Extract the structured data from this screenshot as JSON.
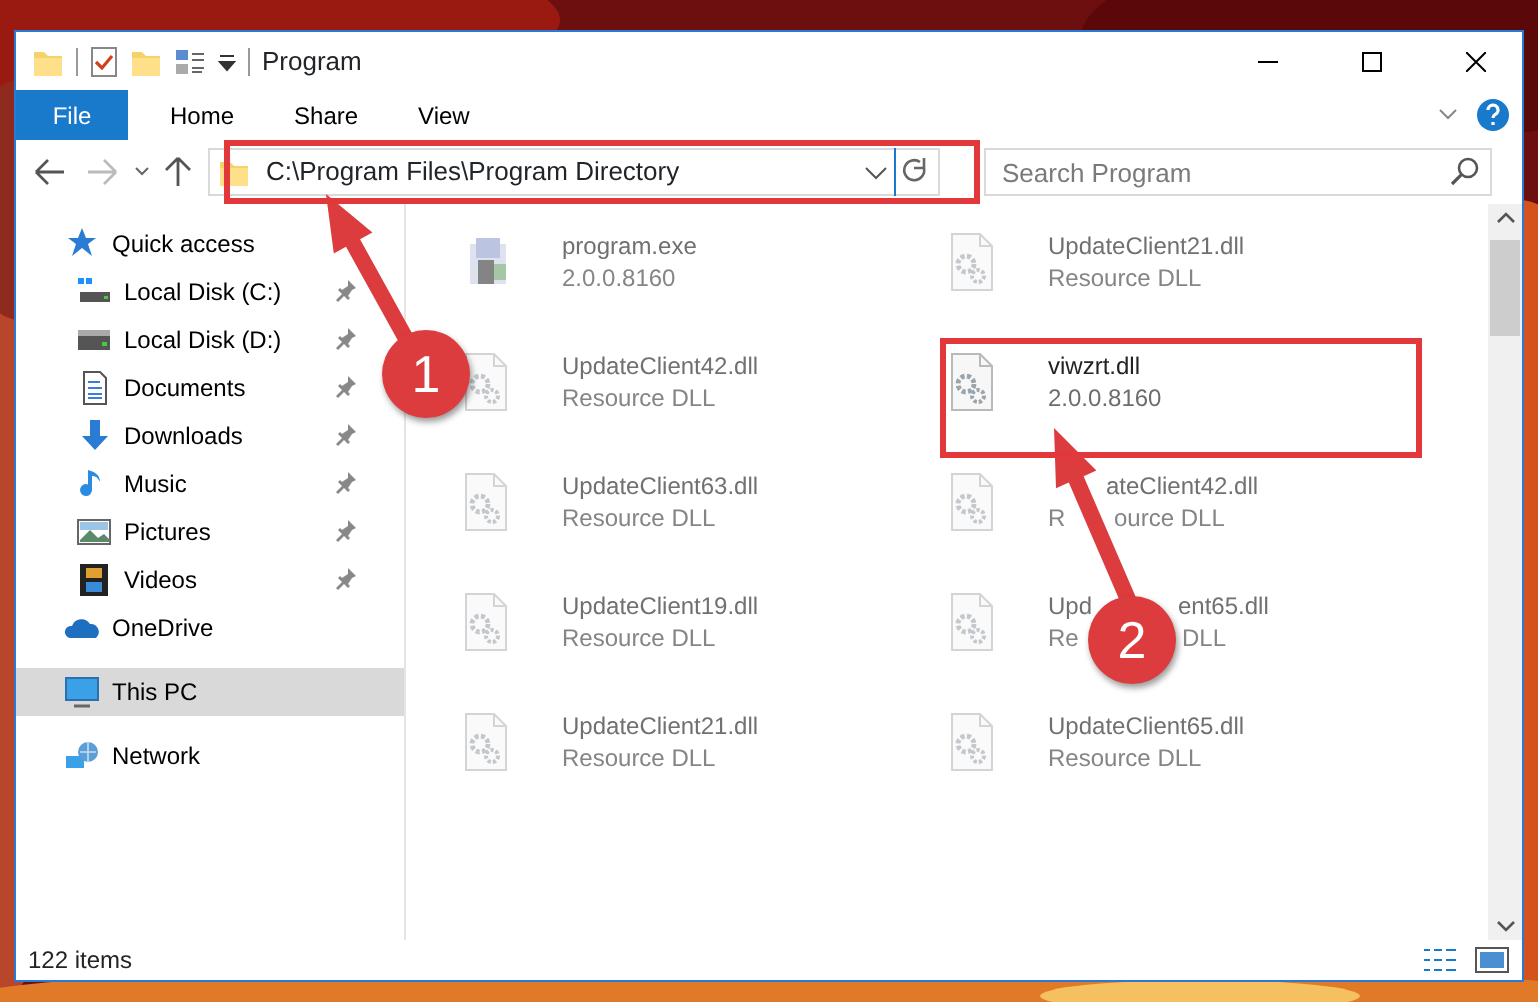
{
  "window": {
    "title": "Program"
  },
  "ribbon_tabs": [
    {
      "label": "File",
      "kind": "menu"
    },
    {
      "label": "Home",
      "kind": "tab"
    },
    {
      "label": "Share",
      "kind": "tab"
    },
    {
      "label": "View",
      "kind": "tab"
    }
  ],
  "address": {
    "path": "C:\\Program Files\\Program Directory"
  },
  "search": {
    "placeholder": "Search Program"
  },
  "navigation": [
    {
      "label": "Quick access",
      "kind": "star",
      "selected": false,
      "children": [
        {
          "label": "Local Disk (C:)",
          "kind": "system-drive",
          "pinned": true
        },
        {
          "label": "Local Disk (D:)",
          "kind": "drive",
          "pinned": true
        },
        {
          "label": "Documents",
          "kind": "documents",
          "pinned": true
        },
        {
          "label": "Downloads",
          "kind": "downloads",
          "pinned": true
        },
        {
          "label": "Music",
          "kind": "music",
          "pinned": true
        },
        {
          "label": "Pictures",
          "kind": "pictures",
          "pinned": true
        },
        {
          "label": "Videos",
          "kind": "videos",
          "pinned": true
        }
      ]
    },
    {
      "label": "OneDrive",
      "kind": "cloud",
      "selected": false
    },
    {
      "label": "This PC",
      "kind": "pc",
      "selected": true
    },
    {
      "label": "Network",
      "kind": "network",
      "selected": false
    }
  ],
  "files": [
    {
      "name": "program.exe",
      "detail": "2.0.0.8160",
      "kind": "exe",
      "blurred": true
    },
    {
      "name": "UpdateClient21.dll",
      "detail": "Resource DLL",
      "kind": "dll",
      "blurred": true
    },
    {
      "name": "UpdateClient42.dll",
      "detail": "Resource DLL",
      "kind": "dll",
      "blurred": true
    },
    {
      "name": "viwzrt.dll",
      "detail": "2.0.0.8160",
      "kind": "dll",
      "blurred": false
    },
    {
      "name": "UpdateClient63.dll",
      "detail": "Resource DLL",
      "kind": "dll",
      "blurred": true
    },
    {
      "name": [
        "ateClient42.dll"
      ],
      "detail": [
        "R",
        "ource DLL"
      ],
      "kind": "dll",
      "blurred": true
    },
    {
      "name": "UpdateClient19.dll",
      "detail": "Resource DLL",
      "kind": "dll",
      "blurred": true
    },
    {
      "name": [
        "Upd",
        "ent65.dll"
      ],
      "detail": [
        "Re",
        "DLL"
      ],
      "kind": "dll",
      "blurred": true
    },
    {
      "name": "UpdateClient21.dll",
      "detail": "Resource DLL",
      "kind": "dll",
      "blurred": true
    },
    {
      "name": "UpdateClient65.dll",
      "detail": "Resource DLL",
      "kind": "dll",
      "blurred": true
    }
  ],
  "annotations": [
    {
      "number": "1"
    },
    {
      "number": "2"
    }
  ],
  "status_bar": {
    "item_count": "122 items"
  }
}
